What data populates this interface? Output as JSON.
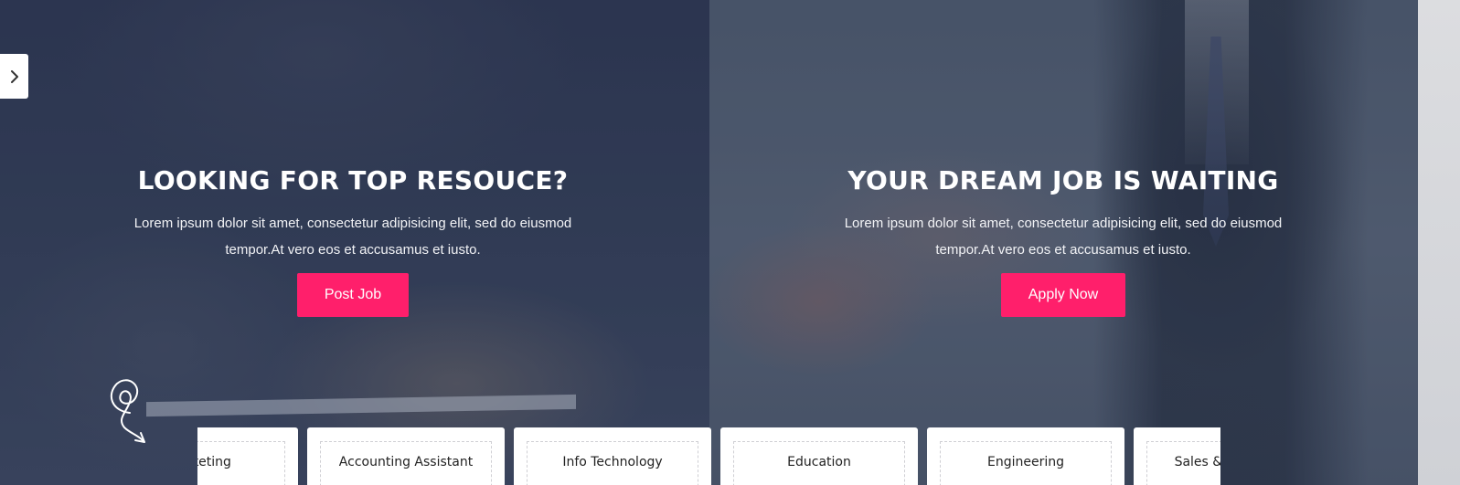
{
  "hero_left": {
    "title": "LOOKING FOR TOP RESOUCE?",
    "text": "Lorem ipsum dolor sit amet, consectetur adipisicing elit, sed do eiusmod tempor.At vero eos et accusamus et iusto.",
    "button_label": "Post Job"
  },
  "hero_right": {
    "title": "YOUR DREAM JOB IS WAITING",
    "text": "Lorem ipsum dolor sit amet, consectetur adipisicing elit, sed do eiusmod tempor.At vero eos et accusamus et iusto.",
    "button_label": "Apply Now"
  },
  "side_toggle": {
    "icon": "chevron-right-icon"
  },
  "categories": [
    {
      "label": "Marketing"
    },
    {
      "label": "Accounting Assistant"
    },
    {
      "label": "Info Technology"
    },
    {
      "label": "Education"
    },
    {
      "label": "Engineering"
    },
    {
      "label": "Sales & Marketing"
    }
  ],
  "colors": {
    "accent": "#ff1f6b",
    "hero_text": "#ffffff",
    "card_bg": "#ffffff"
  }
}
